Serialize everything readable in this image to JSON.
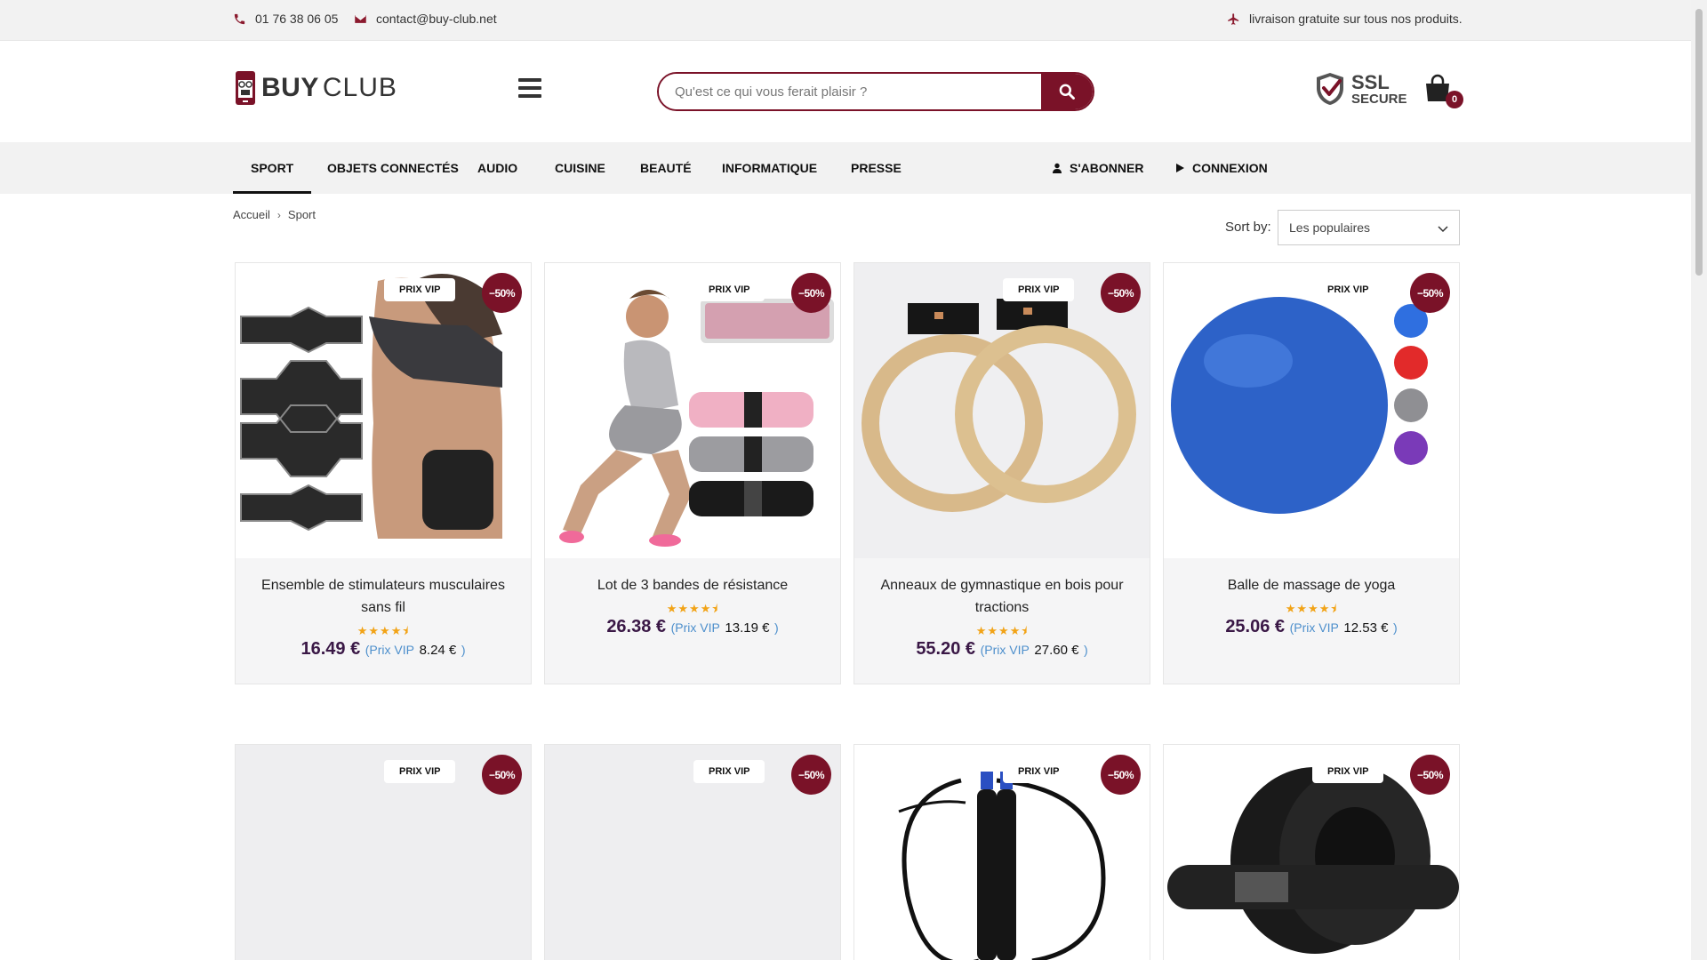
{
  "topbar": {
    "phone": "01 76 38 06 05",
    "email": "contact@buy-club.net",
    "shipping": "livraison gratuite sur tous nos produits."
  },
  "header": {
    "logo_buy": "BUY",
    "logo_club": "CLUB",
    "search_placeholder": "Qu'est ce qui vous ferait plaisir ?",
    "ssl_top": "SSL",
    "ssl_bottom": "SECURE",
    "cart_count": "0"
  },
  "nav": {
    "items": [
      "SPORT",
      "OBJETS CONNECTÉS",
      "AUDIO",
      "CUISINE",
      "BEAUTÉ",
      "INFORMATIQUE",
      "PRESSE"
    ],
    "subscribe": "S'ABONNER",
    "login": "CONNEXION"
  },
  "breadcrumb": {
    "home": "Accueil",
    "current": "Sport"
  },
  "sort": {
    "label": "Sort by:",
    "value": "Les populaires"
  },
  "badges": {
    "vip": "PRIX VIP",
    "discount": "−50%"
  },
  "products": [
    {
      "name": "Ensemble de stimulateurs musculaires sans fil",
      "stars": "★★★★⯨",
      "price": "16.49 €",
      "vip_label": "(Prix VIP",
      "vip_price": "8.24 €",
      "close": ")"
    },
    {
      "name": "Lot de 3 bandes de résistance",
      "stars": "★★★★⯨",
      "price": "26.38 €",
      "vip_label": "(Prix VIP",
      "vip_price": "13.19 €",
      "close": ")"
    },
    {
      "name": "Anneaux de gymnastique en bois pour tractions",
      "stars": "★★★★⯨",
      "price": "55.20 €",
      "vip_label": "(Prix VIP",
      "vip_price": "27.60 €",
      "close": ")"
    },
    {
      "name": "Balle de massage de yoga",
      "stars": "★★★★⯨",
      "price": "25.06 €",
      "vip_label": "(Prix VIP",
      "vip_price": "12.53 €",
      "close": ")"
    }
  ],
  "colors": {
    "brand": "#7a1228",
    "price": "#3a1846",
    "vip_link": "#4d8fcc",
    "stars": "#f2a316"
  }
}
